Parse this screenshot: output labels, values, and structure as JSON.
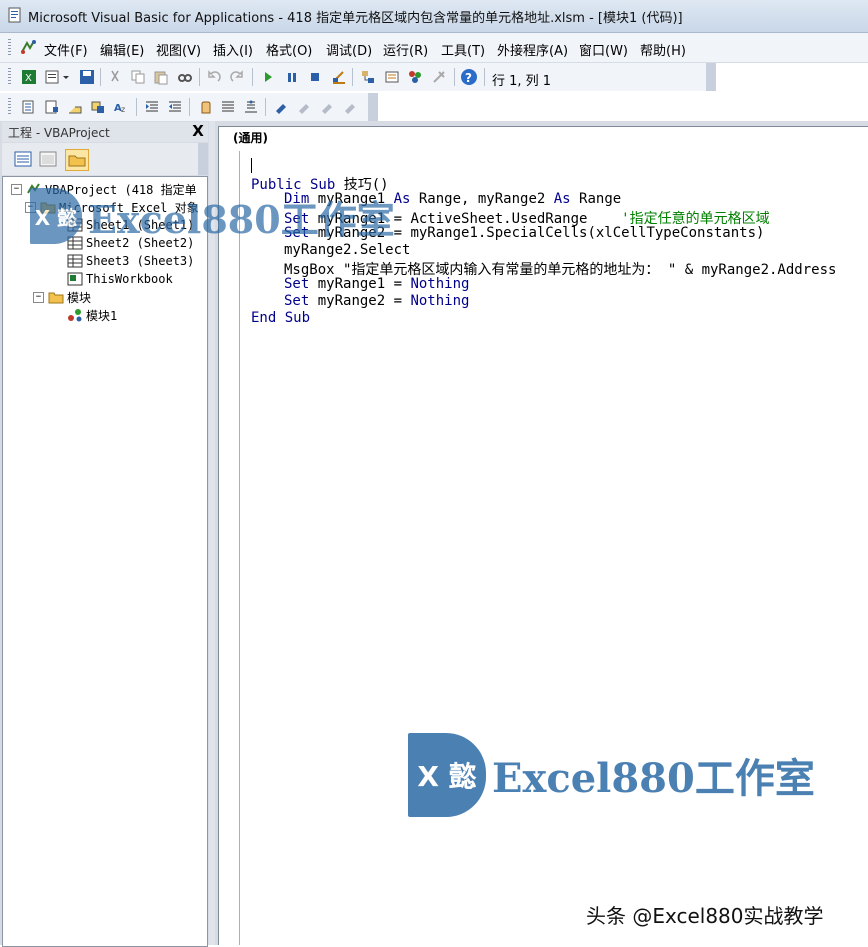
{
  "window": {
    "title": "Microsoft Visual Basic for Applications - 418 指定单元格区域内包含常量的单元格地址.xlsm - [模块1 (代码)]"
  },
  "menu": [
    {
      "label": "文件(F)"
    },
    {
      "label": "编辑(E)"
    },
    {
      "label": "视图(V)"
    },
    {
      "label": "插入(I)"
    },
    {
      "label": "格式(O)"
    },
    {
      "label": "调试(D)"
    },
    {
      "label": "运行(R)"
    },
    {
      "label": "工具(T)"
    },
    {
      "label": "外接程序(A)"
    },
    {
      "label": "窗口(W)"
    },
    {
      "label": "帮助(H)"
    }
  ],
  "toolbar": {
    "position": "行 1, 列 1"
  },
  "project": {
    "title": "工程 - VBAProject",
    "close": "X",
    "tree": [
      {
        "label": "VBAProject (418 指定单"
      },
      {
        "label": "Microsoft Excel 对象"
      },
      {
        "label": "Sheet1 (Sheet1)"
      },
      {
        "label": "Sheet2 (Sheet2)"
      },
      {
        "label": "Sheet3 (Sheet3)"
      },
      {
        "label": "ThisWorkbook"
      },
      {
        "label": "模块"
      },
      {
        "label": "模块1"
      }
    ]
  },
  "code": {
    "object_combo": "(通用)",
    "lines": {
      "l1_kw1": "Public Sub",
      "l1_rest": " 技巧()",
      "l2_kw1": "Dim",
      "l2_a": " myRange1 ",
      "l2_kw2": "As",
      "l2_b": " Range, myRange2 ",
      "l2_kw3": "As",
      "l2_c": " Range",
      "l3_kw": "Set",
      "l3_a": " myRange1 = ActiveSheet.UsedRange    ",
      "l3_cm": "'指定任意的单元格区域",
      "l4_kw": "Set",
      "l4_a": " myRange2 = myRange1.SpecialCells(xlCellTypeConstants)",
      "l5": "myRange2.Select",
      "l6": "MsgBox \"指定单元格区域内输入有常量的单元格的地址为： \" & myRange2.Address",
      "l7_kw": "Set",
      "l7_a": " myRange1 = ",
      "l7_kw2": "Nothing",
      "l8_kw": "Set",
      "l8_a": " myRange2 = ",
      "l8_kw2": "Nothing",
      "l9_kw": "End Sub"
    }
  },
  "watermark": {
    "logo_text": "X 懿",
    "brand": "Excel880工作室",
    "footer": "头条 @Excel880实战教学"
  },
  "colors": {
    "keyword": "#00008b",
    "comment": "#008000",
    "brand": "#2c6aa5"
  }
}
